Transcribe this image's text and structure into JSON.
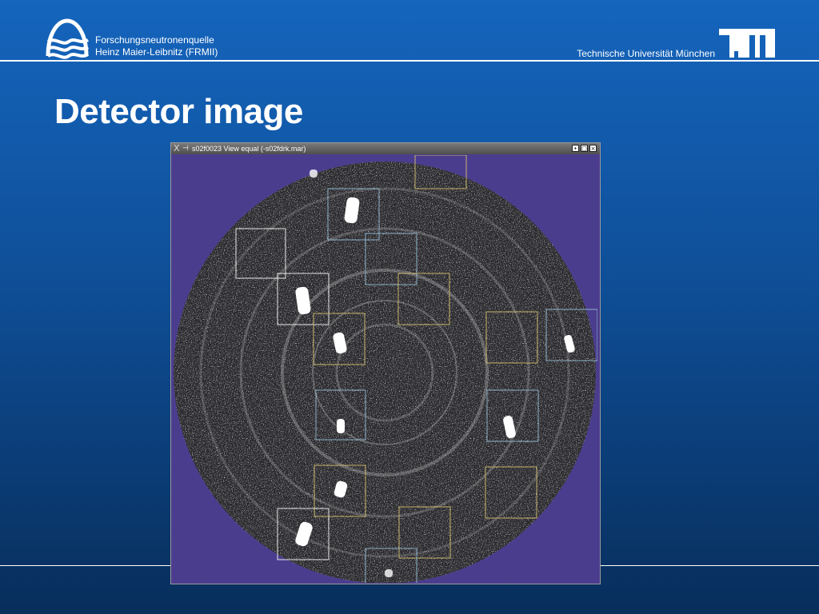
{
  "header": {
    "institute_line1": "Forschungsneutronenquelle",
    "institute_line2": "Heinz Maier-Leibnitz (FRMII)",
    "university": "Technische Universität München",
    "logo_right_icon": "tum-logo-icon",
    "logo_left_icon": "frm-logo-icon"
  },
  "slide": {
    "title": "Detector image"
  },
  "viewer": {
    "title": "s02f0023 View equal (-s02fdrk.mar)",
    "buttons": [
      "minimize-icon",
      "maximize-icon",
      "close-icon"
    ],
    "background_color": "#4b3d8e"
  },
  "colors": {
    "slide_background_top": "#1565bd",
    "slide_background_bottom": "#082e5b",
    "box_white": "#e8e8e8",
    "box_blue": "#8fb2c8",
    "box_yellow": "#c8b46c"
  }
}
